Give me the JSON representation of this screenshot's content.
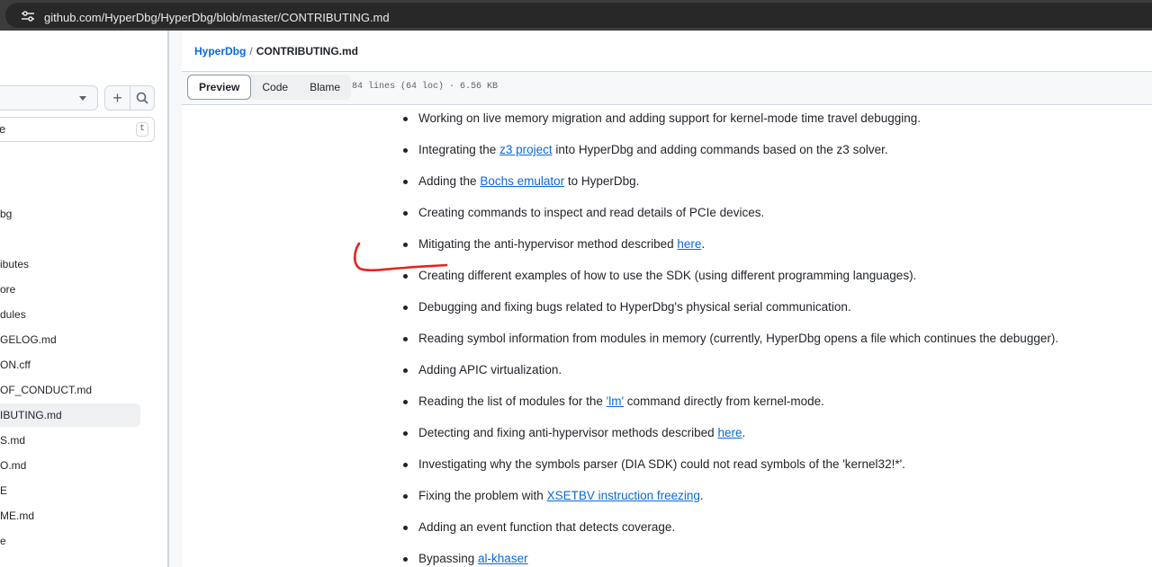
{
  "browser": {
    "url": "github.com/HyperDbg/HyperDbg/blob/master/CONTRIBUTING.md",
    "site_icon": "tune-icon"
  },
  "sidebar": {
    "search_icon": "search-icon",
    "add_icon": "plus-icon",
    "filter": {
      "value": "e",
      "shortcut": "t"
    },
    "items": [
      {
        "label": "bg"
      },
      {
        "label": "ibutes"
      },
      {
        "label": "ore"
      },
      {
        "label": "dules"
      },
      {
        "label": "GELOG.md"
      },
      {
        "label": "ON.cff"
      },
      {
        "label": "OF_CONDUCT.md"
      },
      {
        "label": "IBUTING.md"
      },
      {
        "label": "S.md"
      },
      {
        "label": "O.md"
      },
      {
        "label": "E"
      },
      {
        "label": "ME.md"
      },
      {
        "label": "e"
      }
    ]
  },
  "file": {
    "repo_link": "HyperDbg",
    "separator": "/",
    "filename": "CONTRIBUTING.md",
    "tabs": [
      {
        "label": "Preview"
      },
      {
        "label": "Code"
      },
      {
        "label": "Blame"
      }
    ],
    "meta": "84 lines (64 loc) · 6.56 KB"
  },
  "content": {
    "items": [
      {
        "before": "Working on live memory migration and adding support for kernel-mode time travel debugging.",
        "link": "",
        "after": ""
      },
      {
        "before": "Integrating the ",
        "link": "z3 project",
        "after": " into HyperDbg and adding commands based on the z3 solver."
      },
      {
        "before": "Adding the ",
        "link": "Bochs emulator",
        "after": " to HyperDbg."
      },
      {
        "before": "Creating commands to inspect and read details of PCIe devices.",
        "link": "",
        "after": ""
      },
      {
        "before": "Mitigating the anti-hypervisor method described ",
        "link": "here",
        "after": "."
      },
      {
        "before": "Creating different examples of how to use the SDK (using different programming languages).",
        "link": "",
        "after": ""
      },
      {
        "before": "Debugging and fixing bugs related to HyperDbg's physical serial communication.",
        "link": "",
        "after": ""
      },
      {
        "before": "Reading symbol information from modules in memory (currently, HyperDbg opens a file which continues the debugger).",
        "link": "",
        "after": ""
      },
      {
        "before": "Adding APIC virtualization.",
        "link": "",
        "after": ""
      },
      {
        "before": "Reading the list of modules for the ",
        "link": "'lm'",
        "after": " command directly from kernel-mode."
      },
      {
        "before": "Detecting and fixing anti-hypervisor methods described ",
        "link": "here",
        "after": "."
      },
      {
        "before": "Investigating why the symbols parser (DIA SDK) could not read symbols of the 'kernel32!*'.",
        "link": "",
        "after": ""
      },
      {
        "before": "Fixing the problem with ",
        "link": "XSETBV instruction freezing",
        "after": "."
      },
      {
        "before": "Adding an event function that detects coverage.",
        "link": "",
        "after": ""
      },
      {
        "before": "Bypassing ",
        "link": "al-khaser",
        "after": ""
      }
    ]
  },
  "colors": {
    "accent": "#0969da",
    "annotation": "#e5241f"
  }
}
